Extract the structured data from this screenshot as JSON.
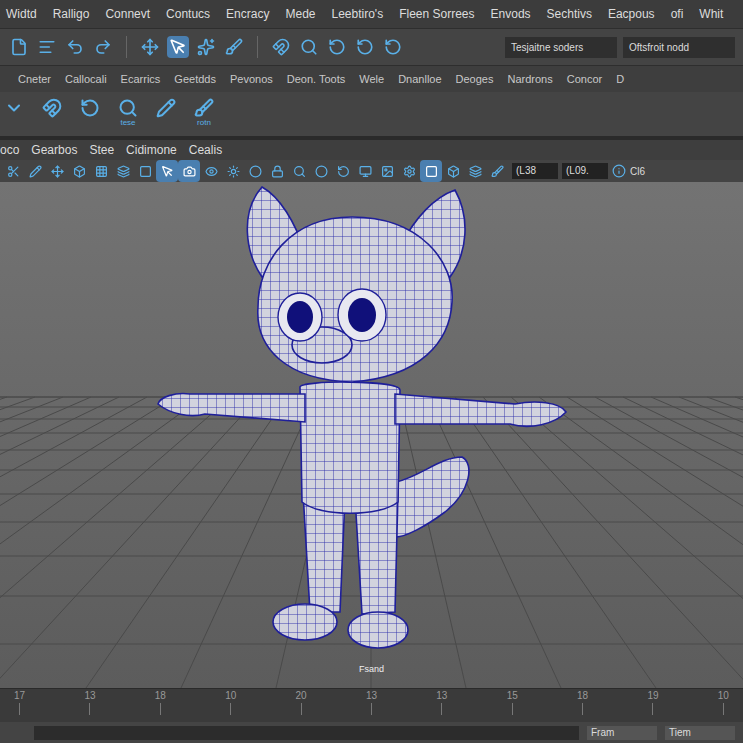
{
  "menu_bar": {
    "items": [
      "Widtd",
      "Ralligo",
      "Connevt",
      "Contucs",
      "Encracy",
      "Mede",
      "Leebtiro's",
      "Fleen Sorrees",
      "Envods",
      "Sechtivs",
      "Eacpous",
      "ofi",
      "Whit"
    ]
  },
  "toolbar": {
    "tools": [
      {
        "selected": false
      },
      {
        "selected": false
      },
      {
        "selected": false
      },
      {
        "selected": false
      },
      {
        "selected": false
      },
      {
        "selected": true
      },
      {
        "selected": false
      },
      {
        "selected": false
      },
      {
        "selected": false
      },
      {
        "selected": false
      },
      {
        "selected": false
      },
      {
        "selected": false
      },
      {
        "selected": false
      }
    ],
    "fields": [
      "Tesjaitne soders",
      "Oftsfroit nodd"
    ]
  },
  "shelf": {
    "tabs": [
      {
        "label": "Cneter",
        "selected": false
      },
      {
        "label": "Callocali",
        "selected": false
      },
      {
        "label": "Ecarrics",
        "selected": false
      },
      {
        "label": "Geetdds",
        "selected": false
      },
      {
        "label": "Pevonos",
        "selected": false
      },
      {
        "label": "Deon. Toots",
        "selected": false
      },
      {
        "label": "Wele",
        "selected": false
      },
      {
        "label": "Dnanlloe",
        "selected": false
      },
      {
        "label": "Deoges",
        "selected": false
      },
      {
        "label": "Nardrons",
        "selected": false
      },
      {
        "label": "Concor",
        "selected": false
      },
      {
        "label": "D",
        "selected": false
      }
    ],
    "tools": [
      {
        "caption": null
      },
      {
        "caption": null
      },
      {
        "caption": null
      },
      {
        "caption": "tese"
      },
      {
        "caption": null
      },
      {
        "caption": "rotn"
      }
    ]
  },
  "panel_menu": {
    "items": [
      "oco",
      "Gearbos",
      "Stee",
      "Cidimone",
      "Cealis"
    ]
  },
  "panel_toolbar": {
    "tools": [
      {
        "selected": false
      },
      {
        "selected": false
      },
      {
        "selected": false
      },
      {
        "selected": false
      },
      {
        "selected": false
      },
      {
        "selected": false
      },
      {
        "selected": false
      },
      {
        "selected": true
      },
      {
        "selected": true
      },
      {
        "selected": false
      },
      {
        "selected": false
      },
      {
        "selected": false
      },
      {
        "selected": false
      },
      {
        "selected": false
      },
      {
        "selected": false
      },
      {
        "selected": false
      },
      {
        "selected": false
      },
      {
        "selected": false
      },
      {
        "selected": false
      },
      {
        "selected": true
      },
      {
        "selected": false
      },
      {
        "selected": false
      },
      {
        "selected": false
      }
    ],
    "fields": [
      "(L38",
      "(L09."
    ],
    "trailing": "Cl6"
  },
  "viewport": {
    "label": "Fsand"
  },
  "timeline": {
    "ticks": [
      "17",
      "13",
      "18",
      "10",
      "20",
      "13",
      "13",
      "15",
      "18",
      "19",
      "10"
    ]
  },
  "status_bar": {
    "fields": [
      "Fram",
      "Tiem"
    ]
  }
}
